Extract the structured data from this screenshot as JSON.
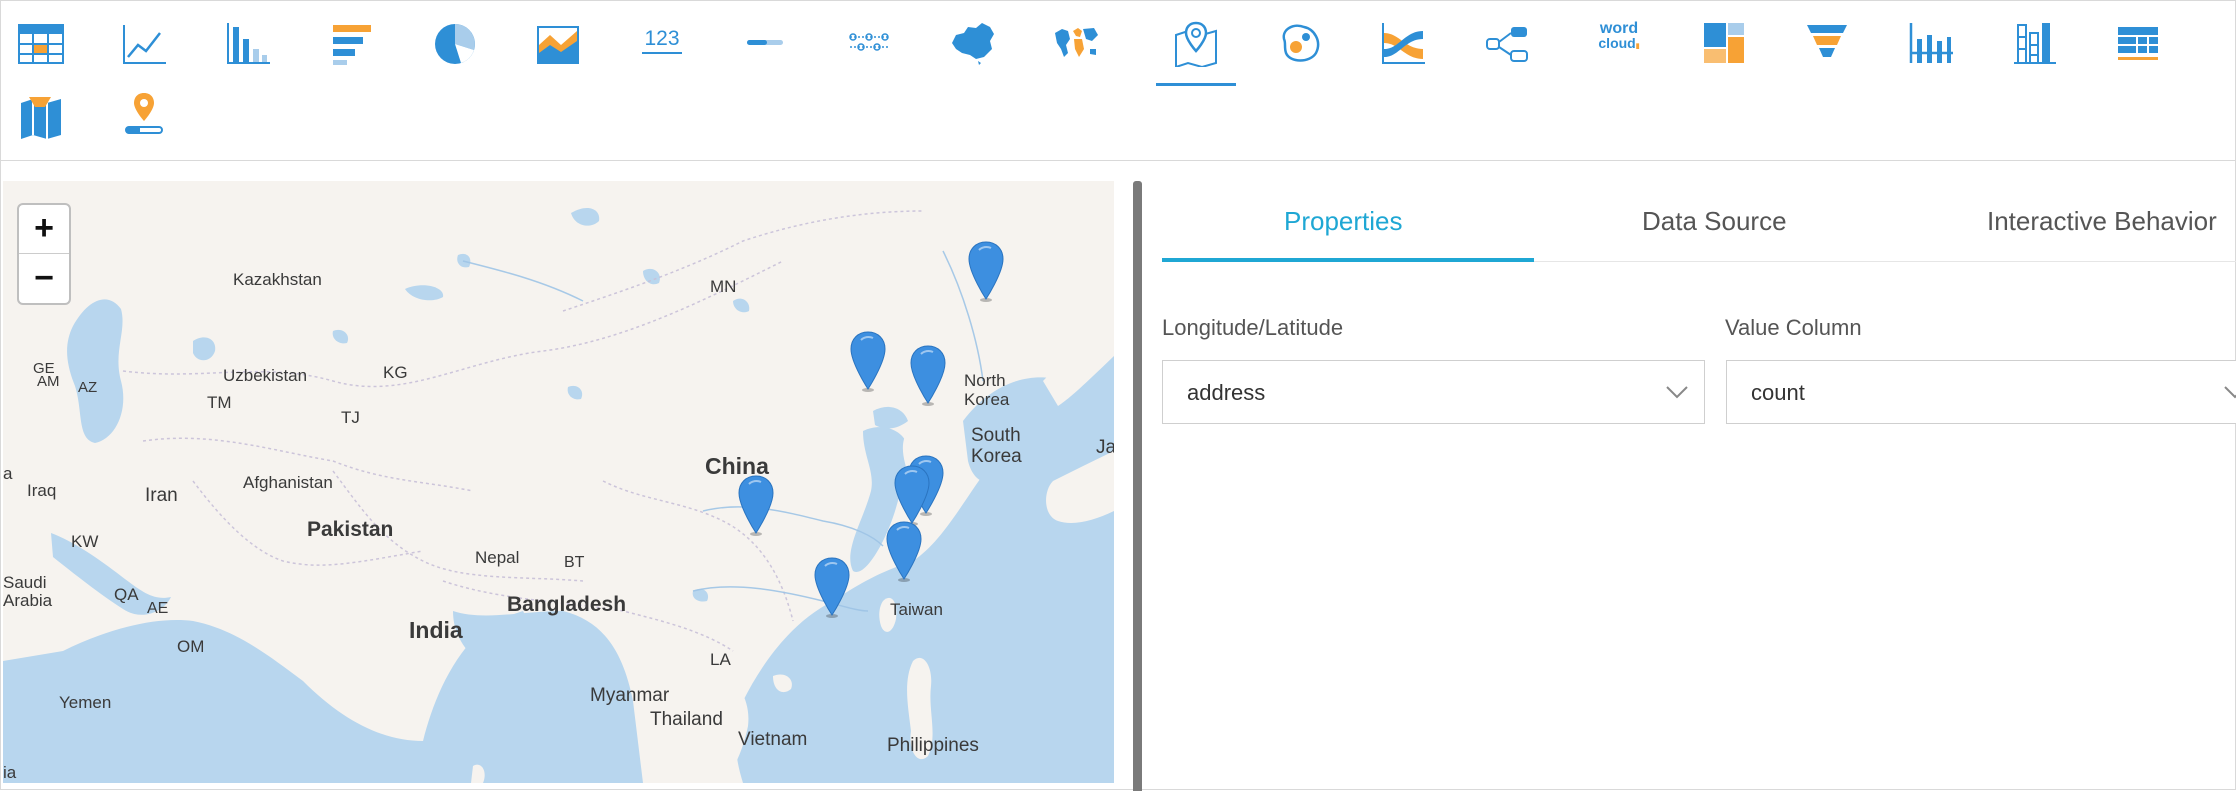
{
  "toolbar": {
    "items": [
      {
        "name": "table-chart-icon"
      },
      {
        "name": "line-chart-icon"
      },
      {
        "name": "bar-chart-icon"
      },
      {
        "name": "horizontal-bar-chart-icon"
      },
      {
        "name": "pie-chart-icon"
      },
      {
        "name": "area-chart-icon"
      },
      {
        "name": "kpi-number-icon",
        "text": "123"
      },
      {
        "name": "progress-bar-icon"
      },
      {
        "name": "flow-dots-icon"
      },
      {
        "name": "china-map-icon"
      },
      {
        "name": "world-map-icon"
      },
      {
        "name": "pin-map-icon",
        "active": true
      },
      {
        "name": "heat-map-icon"
      },
      {
        "name": "sankey-chart-icon"
      },
      {
        "name": "relation-graph-icon"
      },
      {
        "name": "word-cloud-icon",
        "text_line1": "word",
        "text_line2": "cloud"
      },
      {
        "name": "treemap-icon"
      },
      {
        "name": "funnel-chart-icon"
      },
      {
        "name": "waterfall-chart-icon"
      },
      {
        "name": "stacked-bar-icon"
      },
      {
        "name": "crosstab-icon"
      },
      {
        "name": "region-map-icon"
      },
      {
        "name": "location-marker-icon"
      }
    ],
    "colors": {
      "primary": "#2e8fd6",
      "accent": "#f7a235",
      "light": "#a9cdeb"
    }
  },
  "map": {
    "zoom_in": "+",
    "zoom_out": "−",
    "labels": {
      "kazakhstan": "Kazakhstan",
      "mn": "MN",
      "uzbekistan": "Uzbekistan",
      "kg": "KG",
      "ge": "GE",
      "am": "AM",
      "az": "AZ",
      "tm": "TM",
      "tj": "TJ",
      "north_korea_1": "North",
      "north_korea_2": "Korea",
      "south_korea_1": "South",
      "south_korea_2": "Korea",
      "japan": "Ja",
      "china": "China",
      "afghanistan": "Afghanistan",
      "iraq": "Iraq",
      "iran": "Iran",
      "pakistan": "Pakistan",
      "kw": "KW",
      "nepal": "Nepal",
      "bt": "BT",
      "saudi_1": "Saudi",
      "saudi_2": "Arabia",
      "qa": "QA",
      "ae": "AE",
      "bangladesh": "Bangladesh",
      "taiwan": "Taiwan",
      "india": "India",
      "om": "OM",
      "la": "LA",
      "yemen": "Yemen",
      "myanmar": "Myanmar",
      "thailand": "Thailand",
      "vietnam": "Vietnam",
      "philippines": "Philippines",
      "ia": "ia",
      "a": "a"
    },
    "colors": {
      "land": "#f6f3ef",
      "water": "#b8d6ee",
      "marker": "#3d8fe0"
    },
    "marker_count": 9
  },
  "panel": {
    "tabs": [
      {
        "label": "Properties",
        "active": true
      },
      {
        "label": "Data Source",
        "active": false
      },
      {
        "label": "Interactive Behavior",
        "active": false
      }
    ],
    "longitude_latitude_label": "Longitude/Latitude",
    "longitude_latitude_value": "address",
    "value_column_label": "Value Column",
    "value_column_value": "count",
    "accent": "#1fa7d4"
  }
}
